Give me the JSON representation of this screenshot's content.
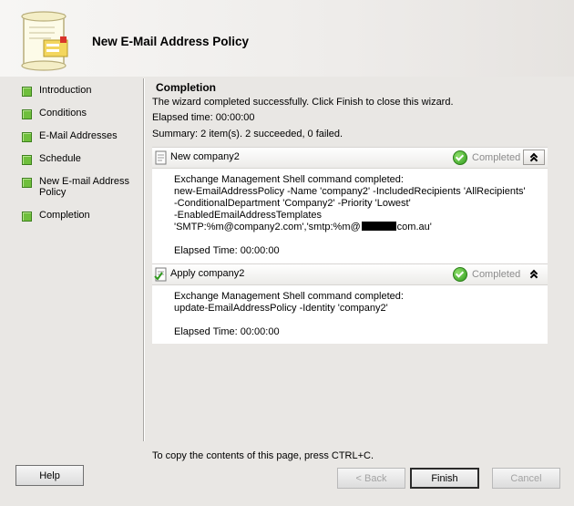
{
  "window": {
    "title": "New E-Mail Address Policy"
  },
  "nav": [
    {
      "label": "Introduction"
    },
    {
      "label": "Conditions"
    },
    {
      "label": "E-Mail Addresses"
    },
    {
      "label": "Schedule"
    },
    {
      "label": "New E-mail Address Policy"
    },
    {
      "label": "Completion"
    }
  ],
  "page": {
    "title": "Completion",
    "message": "The wizard completed successfully. Click Finish to close this wizard.",
    "elapsed": "Elapsed time: 00:00:00",
    "summary": "Summary: 2 item(s). 2 succeeded, 0 failed."
  },
  "tasks": [
    {
      "name": "New company2",
      "status": "Completed",
      "lines": [
        "Exchange Management Shell command completed:",
        "new-EmailAddressPolicy -Name 'company2' -IncludedRecipients 'AllRecipients'",
        "-ConditionalDepartment 'Company2' -Priority 'Lowest'",
        "-EnabledEmailAddressTemplates",
        "'SMTP:%m@company2.com','smtp:%m@",
        "com.au'"
      ],
      "elapsed": "Elapsed Time: 00:00:00"
    },
    {
      "name": "Apply company2",
      "status": "Completed",
      "lines": [
        "Exchange Management Shell command completed:",
        "update-EmailAddressPolicy -Identity 'company2'"
      ],
      "elapsed": "Elapsed Time: 00:00:00"
    }
  ],
  "footer": {
    "copy_hint": "To copy the contents of this page, press CTRL+C."
  },
  "buttons": {
    "help": "Help",
    "back": "< Back",
    "finish": "Finish",
    "cancel": "Cancel"
  },
  "colors": {
    "nav_square": "#6fbf3c",
    "status_text": "#8c8c8c",
    "check": "#2f9a1d"
  },
  "icons": {
    "wizard": "scroll-document-icon",
    "task1": "document-icon",
    "task2": "document-apply-icon",
    "status": "green-check-icon",
    "collapse": "chevron-double-up-icon"
  }
}
